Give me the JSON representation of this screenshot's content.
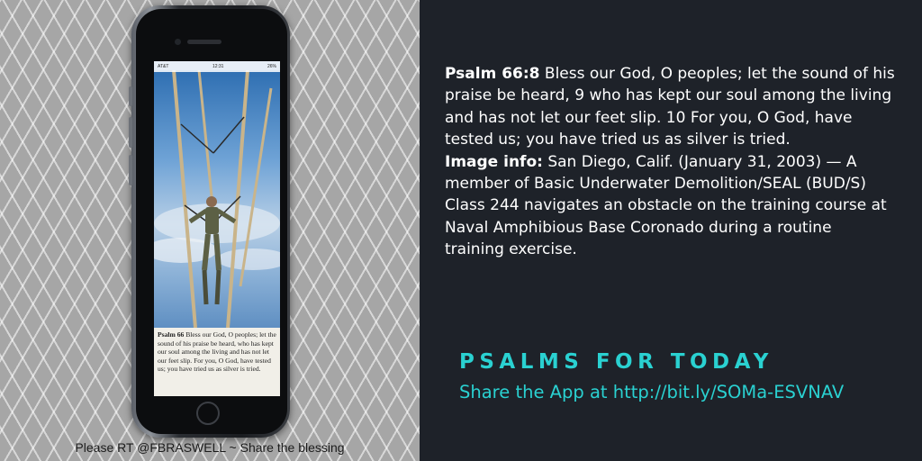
{
  "phone": {
    "status_carrier": "AT&T",
    "status_time": "12:31",
    "status_battery": "26%",
    "screen_verse_ref": "Psalm 66",
    "screen_verse_text": "Bless our God, O peoples; let the sound of his praise be heard, who has kept our soul among the living and has not let our feet slip. For you, O God, have tested us; you have tried us as silver is tried."
  },
  "caption": "Please RT @FBRASWELL ~ Share the blessing",
  "verse": {
    "lead_label": "Psalm 66:8",
    "text": " Bless our God, O peoples; let the sound of his praise be heard, 9 who has kept our soul among the living and has not let our feet slip. 10 For you, O God, have tested us; you have tried us as silver is tried.",
    "image_info_label": "Image info:",
    "image_info_text": " San Diego, Calif. (January 31, 2003) — A member of Basic Underwater Demolition/SEAL (BUD/S) Class 244 navigates an obstacle on the training course at Naval Amphibious Base Coronado during a routine training exercise."
  },
  "brand": {
    "title": "PSALMS FOR TODAY",
    "share_text": "Share the App at  http://bit.ly/SOMa-ESVNAV"
  },
  "colors": {
    "accent": "#2ad1d1",
    "panel_dark": "#1e2229",
    "panel_light": "#a6a6a6"
  }
}
